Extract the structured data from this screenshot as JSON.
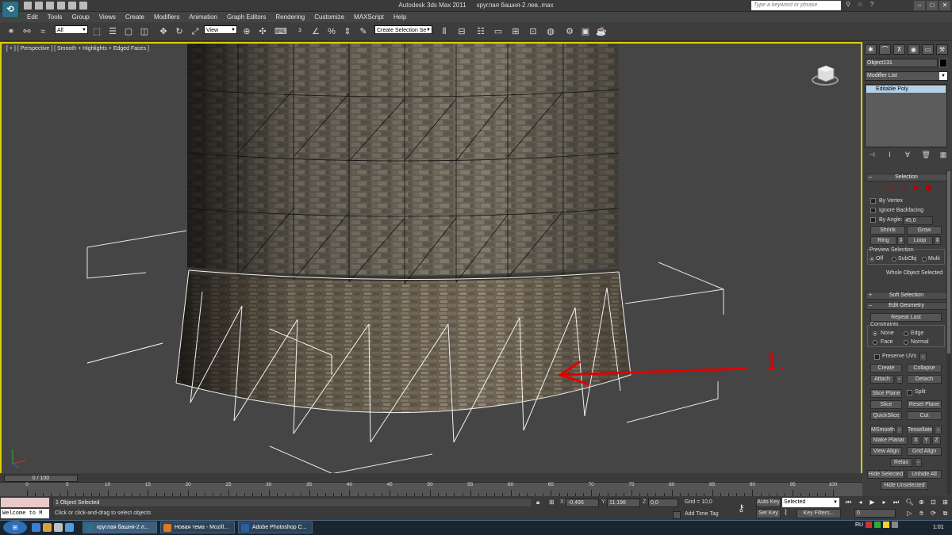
{
  "titlebar": {
    "app_title": "Autodesk 3ds Max  2011",
    "doc_title": "круглая башня-2 лев..max",
    "search_placeholder": "Type a keyword or phrase",
    "app_button": "Max"
  },
  "menu": [
    "Edit",
    "Tools",
    "Group",
    "Views",
    "Create",
    "Modifiers",
    "Animation",
    "Graph Editors",
    "Rendering",
    "Customize",
    "MAXScript",
    "Help"
  ],
  "toolbar": {
    "selection_filter": "All",
    "reference_coord": "View",
    "named_selection": "Create Selection Se"
  },
  "viewport": {
    "label": "[ + ] [ Perspective ] [ Smooth + Highlights + Edged Faces ]",
    "annotation": "1."
  },
  "timeline": {
    "slider_text": "0 / 100",
    "ticks": [
      "0",
      "5",
      "10",
      "15",
      "20",
      "25",
      "30",
      "35",
      "40",
      "45",
      "50",
      "55",
      "60",
      "65",
      "70",
      "75",
      "80",
      "85",
      "90",
      "95",
      "100"
    ]
  },
  "status": {
    "selection_info": "1 Object Selected",
    "prompt": "Click or click-and-drag to select objects",
    "listener": "Welcome to M",
    "x_label": "X:",
    "x_value": "-0,496",
    "y_label": "Y:",
    "y_value": "11,198",
    "z_label": "Z:",
    "z_value": "0,0",
    "grid": "Grid = 10,0",
    "add_time_tag": "Add Time Tag",
    "auto_key": "Auto Key",
    "set_key": "Set Key",
    "key_mode": "Selected",
    "key_filters": "Key Filters...",
    "frame": "0"
  },
  "command_panel": {
    "object_name": "Object131",
    "modifier_list": "Modifier List",
    "stack_item": "Editable Poly",
    "selection": {
      "header": "Selection",
      "by_vertex": "By Vertex",
      "ignore_backfacing": "Ignore Backfacing",
      "by_angle": "By Angle:",
      "angle_value": "45,0",
      "shrink": "Shrink",
      "grow": "Grow",
      "ring": "Ring",
      "loop": "Loop",
      "preview_selection": "Preview Selection",
      "off": "Off",
      "subobj": "SubObj",
      "multi": "Multi",
      "status": "Whole Object Selected"
    },
    "soft_selection": "Soft Selection",
    "edit_geometry": {
      "header": "Edit Geometry",
      "repeat_last": "Repeat Last",
      "constraints": "Constraints",
      "none": "None",
      "edge": "Edge",
      "face": "Face",
      "normal": "Normal",
      "preserve_uvs": "Preserve UVs",
      "create": "Create",
      "collapse": "Collapse",
      "attach": "Attach",
      "detach": "Detach",
      "slice_plane": "Slice Plane",
      "split": "Split",
      "slice": "Slice",
      "reset_plane": "Reset Plane",
      "quickslice": "QuickSlice",
      "cut": "Cut",
      "msmooth": "MSmooth",
      "tessellate": "Tessellate",
      "make_planar": "Make Planar",
      "x": "X",
      "y": "Y",
      "z": "Z",
      "view_align": "View Align",
      "grid_align": "Grid Align",
      "relax": "Relax",
      "hide_selected": "Hide Selected",
      "unhide_all": "Unhide All",
      "hide_unselected": "Hide Unselected"
    }
  },
  "taskbar": {
    "tasks": [
      "круглая башня-2 л...",
      "Новая тема - Mozill...",
      "Adobe Photoshop C..."
    ],
    "lang": "RU",
    "clock": "1:01"
  },
  "colors": {
    "viewport_border": "#d8d000",
    "annotation": "#e00000",
    "stack_highlight": "#b5d1e6"
  }
}
